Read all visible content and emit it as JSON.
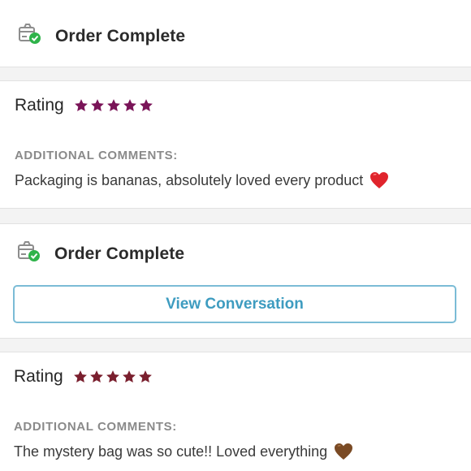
{
  "orders": [
    {
      "status": "Order Complete",
      "status_icon": "package-check-icon"
    },
    {
      "status": "Order Complete",
      "status_icon": "package-check-icon"
    }
  ],
  "reviews": [
    {
      "rating_label": "Rating",
      "stars": 5,
      "star_color": "#7a1458",
      "comments_label": "ADDITIONAL COMMENTS:",
      "comment": "Packaging is bananas, absolutely loved every product",
      "emoji": "red-heart-icon"
    },
    {
      "rating_label": "Rating",
      "stars": 5,
      "star_color": "#7a1f2e",
      "comments_label": "ADDITIONAL COMMENTS:",
      "comment": "The mystery bag was so cute!! Loved everything",
      "emoji": "brown-heart-icon"
    }
  ],
  "actions": {
    "view_conversation": "View Conversation"
  },
  "colors": {
    "accent": "#3e9cc0",
    "check_green": "#2fb34a"
  }
}
